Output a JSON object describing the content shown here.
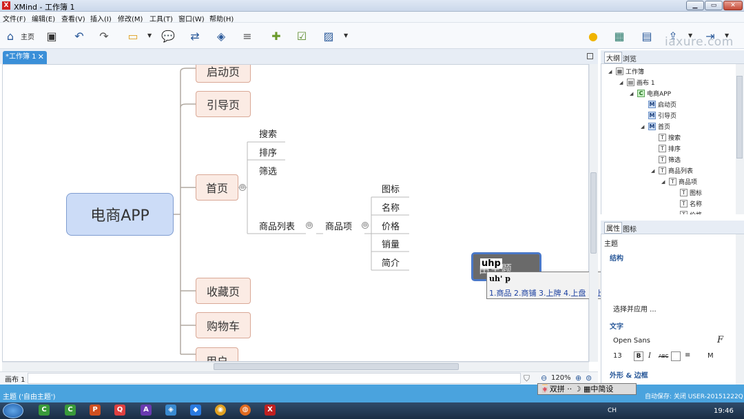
{
  "window": {
    "title": "XMind - 工作簿 1",
    "logo": "X",
    "min": "▁",
    "max": "▭",
    "close": "✕"
  },
  "menu": [
    "文件(F)",
    "编辑(E)",
    "查看(V)",
    "插入(I)",
    "修改(M)",
    "工具(T)",
    "窗口(W)",
    "帮助(H)"
  ],
  "toolbar": {
    "home_label": "主页",
    "watermark": "iaxure.com"
  },
  "editor": {
    "tab_label": "*工作簿 1",
    "tab_close": "✕"
  },
  "mindmap": {
    "central": "电商APP",
    "main_topics": [
      "启动页",
      "引导页",
      "首页",
      "收藏页",
      "购物车",
      "用户"
    ],
    "home_children": [
      "搜索",
      "排序",
      "筛选",
      "商品列表"
    ],
    "product_item": "商品项",
    "product_item_children": [
      "图标",
      "名称",
      "价格",
      "销量",
      "简介"
    ],
    "collapse_symbol": "⊖",
    "floating_topic_text": "由主题",
    "ime_typed": "uhp"
  },
  "ime": {
    "pinyin": "uh' p",
    "candidates": "1.商品 2.商铺 3.上牌 4.上盘 5.上铺",
    "arrow": "◂▸",
    "bar": "🀄双拼 ·· ☽ ▦中简设"
  },
  "sheetbar": {
    "sheet": "画布 1",
    "zoom": "120%",
    "zoom_out": "⊖",
    "zoom_in": "⊕",
    "zoom_fit": "⊜",
    "filter": "⛉"
  },
  "outline": {
    "tabs": [
      "大纲",
      "浏览"
    ],
    "rows": [
      {
        "label": "工作簿",
        "icon": "▦"
      },
      {
        "label": "画布 1",
        "icon": "▤"
      },
      {
        "label": "电商APP",
        "icon": "C"
      },
      {
        "label": "启动页",
        "icon": "M"
      },
      {
        "label": "引导页",
        "icon": "M"
      },
      {
        "label": "首页",
        "icon": "M"
      },
      {
        "label": "搜索",
        "icon": "T"
      },
      {
        "label": "排序",
        "icon": "T"
      },
      {
        "label": "筛选",
        "icon": "T"
      },
      {
        "label": "商品列表",
        "icon": "T"
      },
      {
        "label": "商品项",
        "icon": "T"
      },
      {
        "label": "图标",
        "icon": "T"
      },
      {
        "label": "名称",
        "icon": "T"
      },
      {
        "label": "价格",
        "icon": "T"
      }
    ]
  },
  "properties": {
    "tabs": [
      "属性",
      "图标"
    ],
    "title": "主题",
    "structure": "结构",
    "apply": "选择并应用 ...",
    "text": "文字",
    "font": "Open Sans",
    "font_size": "13",
    "bold": "B",
    "italic": "I",
    "strike": "ABC",
    "align": "≡",
    "case": "M",
    "font_icon": "F",
    "shape_border": "外形 & 边框"
  },
  "status": {
    "left": "主题 ('自由主题')",
    "right": "自动保存: 关闭  USER-20151222Q"
  },
  "taskbar": {
    "lang": "CH",
    "time": "19:46"
  },
  "colors": {
    "accent": "#3a8fd8",
    "status": "#4aa3de",
    "central": "#ccdcf7",
    "topic": "#fbebe4"
  }
}
